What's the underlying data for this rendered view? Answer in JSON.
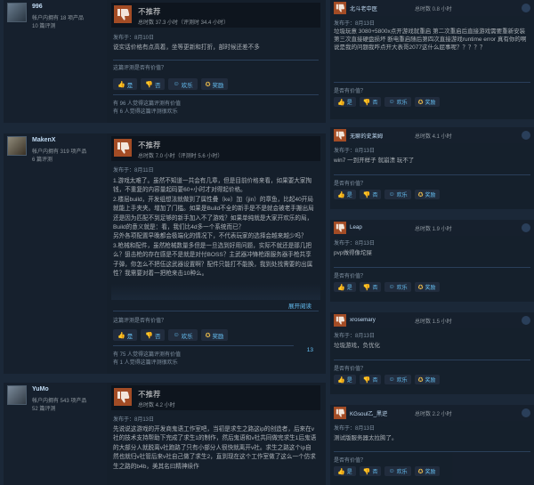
{
  "common": {
    "verdict": "不推荐",
    "helpful_q": "这篇评测是否有价值？",
    "btn_yes": "是",
    "btn_no": "否",
    "btn_funny": "欢乐",
    "btn_award": "奖励",
    "expand": "展开阅读",
    "helpful_q_short": "是否有价值？"
  },
  "reviews": [
    {
      "username": "996",
      "owned": "帐户内拥有 18 项产品",
      "review_count": "10 篇评测",
      "hours": "总时数 37.3 小时（评测时 34.4 小时）",
      "posted": "发布于：8月10日",
      "text": "说实话价格有点高着，坐等更新和打折，部时候还差不多",
      "helpful_stat": "有 96 人觉得这篇评测有价值",
      "funny_stat": "有 6 人觉得这篇评测很欢乐"
    },
    {
      "username": "MakenX",
      "owned": "帐户内拥有 319 项产品",
      "review_count": "6 篇评测",
      "hours": "总时数 7.0 小时（评测时 5.6 小时）",
      "posted": "发布于：8月11日",
      "text": "1.游戏太难了。虽然不知道一共会有几章，但是目前价格来看，如果要大家掏钱，不重复的内容量起码要60+小时才对得起价格。\n2.楼层build，开发组想法就做到了属性叠（ke）加（jin）的章鱼，比起40开局就能上手夹夹。增加了门槛。如果是Build不全的新手是不是就会被老手搬出局还是因为匹配不到足够的新手加入不了游戏？如果单纯就是大家开欢乐的局，Build的意义就是：看，我们比4d多一个系统而已？\n另外各项配置早晚都会极端化的情况下，不代表玩家的选择会越来越少吗？\n3.枪械和配件，虽然枪械数量多但是一旦选到好用问题，实际不就还是那几把么？狙击枪的存在感是不是就是对付BOSS？主武器冲锋枪跟服务器手枪共享子弹，你怎么不把伍这武器设置啊？配件只能打不能换，我到处找需要的出属性？我需要对着一把枪来击10种么。",
      "helpful_stat": "有 75 人觉得这篇评测有价值",
      "funny_stat": "有 1 人觉得这篇评测很欢乐",
      "comments": "13"
    },
    {
      "username": "YuMo",
      "owned": "帐户内拥有 543 项产品",
      "review_count": "52 篇评测",
      "hours": "总时数 4.2 小时",
      "posted": "发布于：8月13日",
      "text": "先说说这游戏的开发商鬼语工作室吧，当初是求生之路这ip的创造者，后来在v社的技术支持帮助下完成了求生1的制作，然后鬼语和v社共同做完求生1后鬼语的大部分人就脱离v社跑路了只有小部分人很快就离开v社。求生之路这个ip自然也就归v社管后来v社自己做了求生2，直到现在这个工作室做了这么一个仿求生之路的b4b，美其名曰精神续作"
    }
  ],
  "right_reviews": [
    {
      "username": "北斗老中医",
      "hours": "总时数 0.8 小时",
      "posted": "发布于：8月13日",
      "text": "垃圾玩意 3080+5800x点开游戏就重启 第二次重启后直接游戏需要重新安装 第三次直接硬盘损坏 断电重启随后第四次直接游戏runtime error 真有你的啊 说是我的问题我咋点开大表哥2077这什么屁事呢？？？？？"
    },
    {
      "username": "无聊的史莱姆",
      "hours": "总时数 4.1 小时",
      "posted": "发布于：8月13日",
      "text": "win7 一到开样子 就崩溃 玩不了"
    },
    {
      "username": "Leap",
      "hours": "总时数 1.9 小时",
      "posted": "发布于：8月13日",
      "text": "pvp做得像坨屎"
    },
    {
      "username": "xrosemary",
      "hours": "总时数 1.5 小时",
      "posted": "发布于：8月13日",
      "text": "垃圾游戏，负优化"
    },
    {
      "username": "KGsoul乙_黑逆",
      "hours": "总时数 2.2 小时",
      "posted": "发布于：8月13日",
      "text": "测试版服务器太拉胯了。"
    }
  ]
}
